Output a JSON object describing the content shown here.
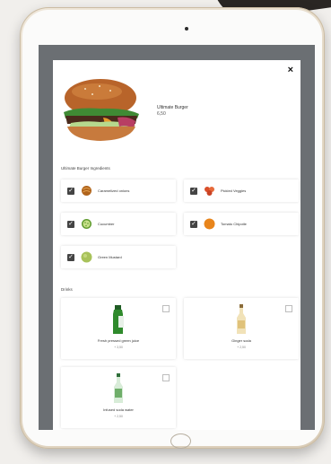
{
  "product": {
    "name": "Ultimate Burger",
    "price": "6,50",
    "close_symbol": "×"
  },
  "ingredients": {
    "heading": "Ultimate Burger Ingredients",
    "items": [
      {
        "label": "Caramelized onions",
        "checked": true,
        "icon": "onion-icon"
      },
      {
        "label": "Pickled Veggies",
        "checked": true,
        "icon": "pickled-veggies-icon"
      },
      {
        "label": "Cucumber",
        "checked": true,
        "icon": "cucumber-icon"
      },
      {
        "label": "Tomato Chipotle",
        "checked": true,
        "icon": "tomato-sauce-icon"
      },
      {
        "label": "Green Mustard",
        "checked": true,
        "icon": "mustard-icon"
      }
    ]
  },
  "drinks": {
    "heading": "Drinks",
    "items": [
      {
        "name": "Fresh pressed green juice",
        "price": "+ 3,50",
        "checked": false,
        "icon": "green-juice-bottle-icon"
      },
      {
        "name": "Ginger soda",
        "price": "+ 2,50",
        "checked": false,
        "icon": "ginger-soda-bottle-icon"
      },
      {
        "name": "Infused soda water",
        "price": "+ 2,50",
        "checked": false,
        "icon": "soda-water-bottle-icon"
      }
    ]
  },
  "colors": {
    "backdrop": "#6b6f73",
    "checkbox": "#444444",
    "device_frame": "#e5dac8"
  }
}
